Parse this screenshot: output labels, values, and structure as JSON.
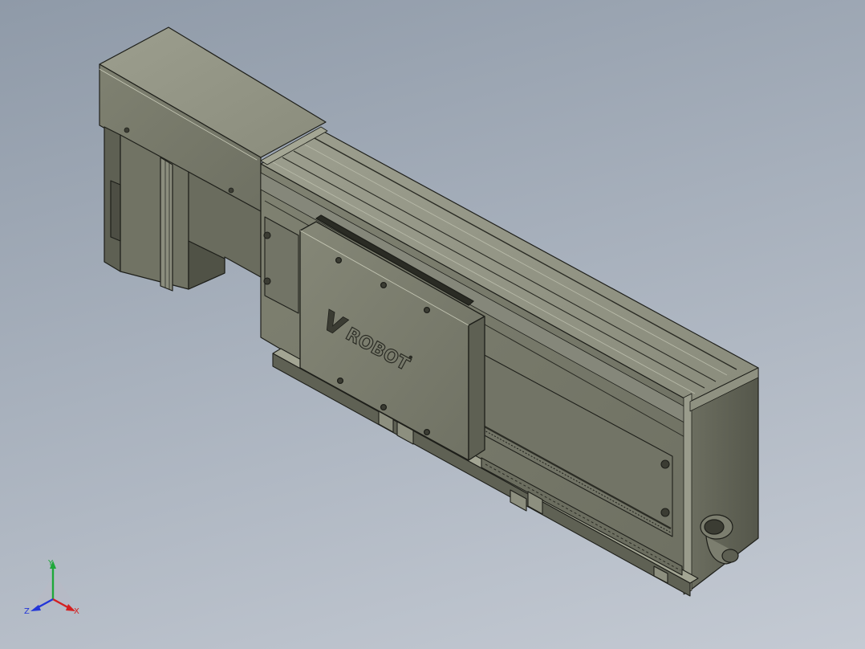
{
  "model": {
    "brand_logo": "ROBOT",
    "colors": {
      "body": "#787a6a",
      "body_dark": "#5a5c4f",
      "body_light": "#9a9c8c",
      "edge": "#1e1f1a",
      "background_top": "#8f9aa8",
      "background_bottom": "#c4cad3"
    }
  },
  "triad": {
    "x_label": "X",
    "y_label": "Y",
    "z_label": "Z",
    "x_color": "#d42020",
    "y_color": "#1fa83a",
    "z_color": "#2236d8"
  }
}
